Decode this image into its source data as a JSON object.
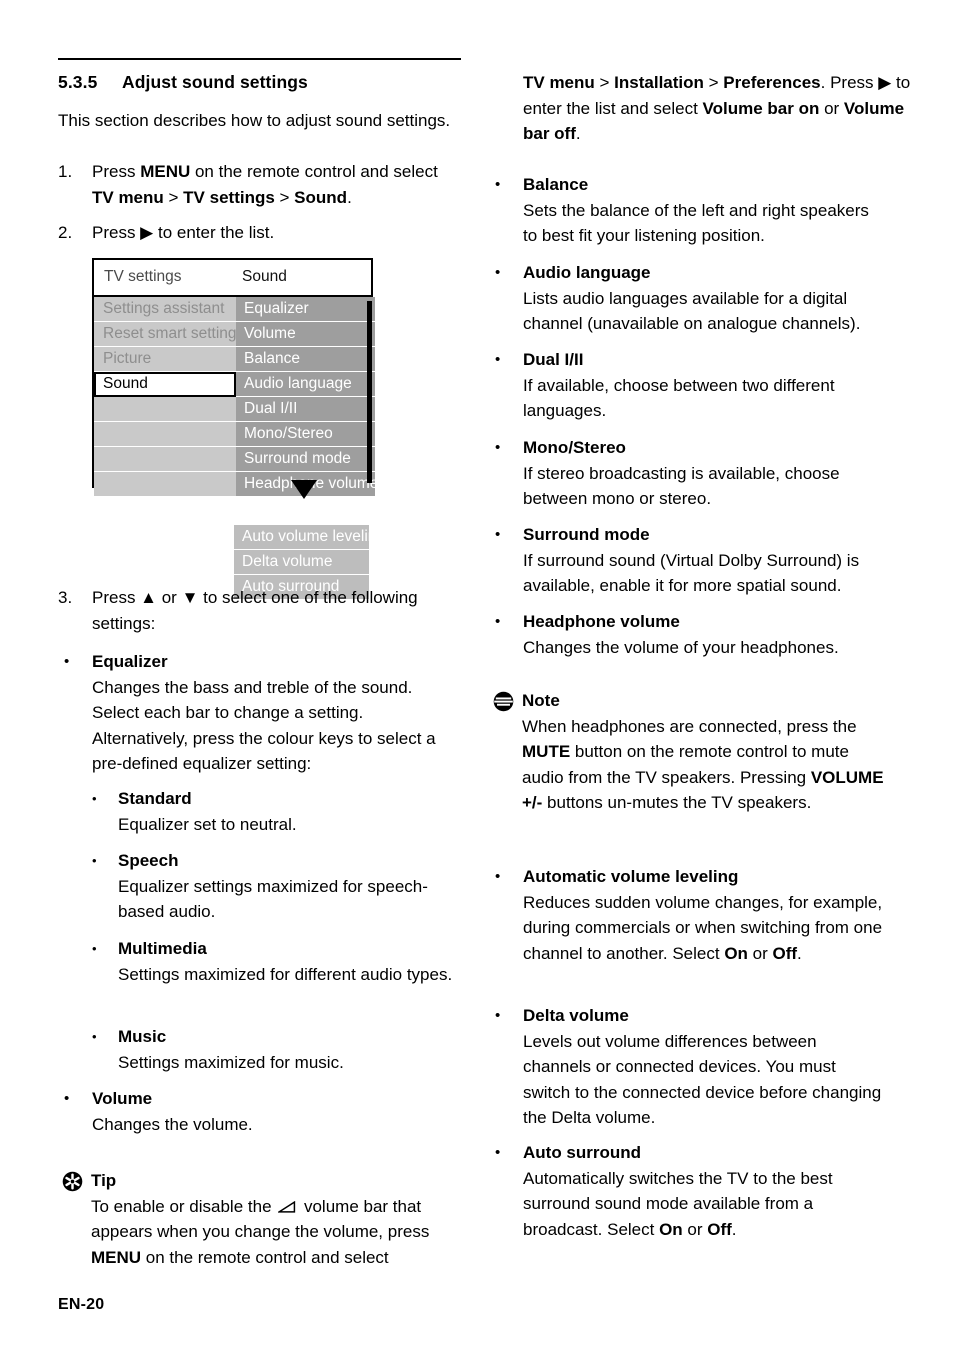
{
  "page": {
    "footer": "EN-20",
    "section_number": "5.3.5",
    "section_title": "Adjust sound settings"
  },
  "left_column": {
    "intro": "This section describes how to adjust sound settings.",
    "steps": [
      {
        "number": "1.",
        "text_parts": [
          {
            "t": "Press ",
            "bold": false
          },
          {
            "t": "MENU",
            "bold": true
          },
          {
            "t": " on the remote control and select ",
            "bold": false
          },
          {
            "t": "TV menu",
            "bold": true
          },
          {
            "t": " > ",
            "bold": false
          },
          {
            "t": "TV settings",
            "bold": true
          },
          {
            "t": " > ",
            "bold": false
          },
          {
            "t": "Sound",
            "bold": true
          },
          {
            "t": ".",
            "bold": false
          }
        ],
        "plain": "Press MENU on the remote control and select TV menu > TV settings > Sound."
      },
      {
        "number": "2.",
        "plain": "Press ▶ to enter the list."
      },
      {
        "number": "3.",
        "plain": "Press ▲ or ▼ to select one of the following settings:"
      }
    ],
    "bullets": [
      {
        "term": "Equalizer",
        "desc": "Changes the bass and treble of the sound. Select each bar to change a setting. Alternatively, press the colour keys to select a pre-defined equalizer setting:",
        "subbullets": [
          {
            "term": "Standard",
            "desc": "Equalizer set to neutral."
          },
          {
            "term": "Speech",
            "desc": "Equalizer settings maximized for speech-based audio."
          },
          {
            "term": "Multimedia",
            "desc": "Settings maximized for different audio types."
          },
          {
            "term": "Music",
            "desc": "Settings maximized for music."
          }
        ]
      },
      {
        "term": "Volume",
        "desc": "Changes the volume."
      }
    ],
    "tip": {
      "icon": "tip-asterisk-icon",
      "heading": "Tip",
      "body_pre": "To enable or disable the ",
      "glyph": "volume-bar-icon",
      "body_mid": " volume bar that appears when you change the volume, press ",
      "body_bold": "MENU",
      "body_post": " on the remote control and select"
    }
  },
  "tv_menu": {
    "header_left": "TV settings",
    "header_right": "Sound",
    "left_items": [
      {
        "label": "Settings assistant",
        "state": "normal"
      },
      {
        "label": "Reset smart settings",
        "state": "normal"
      },
      {
        "label": "Picture",
        "state": "normal"
      },
      {
        "label": "Sound",
        "state": "selected"
      },
      {
        "label": "",
        "state": "blank"
      },
      {
        "label": "",
        "state": "blank"
      },
      {
        "label": "",
        "state": "blank"
      },
      {
        "label": "",
        "state": "blank"
      }
    ],
    "right_items": [
      "Equalizer",
      "Volume",
      "Balance",
      "Audio language",
      "Dual I/II",
      "Mono/Stereo",
      "Surround mode",
      "Headphone volume"
    ],
    "overflow_items": [
      "Auto volume leveling",
      "Delta volume",
      "Auto surround"
    ],
    "colors": {
      "left_row_bg": "#c9c9c9",
      "left_row_text": "#8e8e8e",
      "right_row_bg": "#9e9e9e",
      "right_row_text": "#ffffff",
      "overflow_row_bg": "#bdbdbd",
      "scrollbar": "#000000",
      "selected_bg": "#ffffff",
      "selected_text": "#000000"
    }
  },
  "right_column": {
    "continuation": {
      "line1_parts": [
        {
          "t": "TV menu",
          "bold": true
        },
        {
          "t": " > ",
          "bold": false
        },
        {
          "t": "Installation",
          "bold": true
        },
        {
          "t": " > ",
          "bold": false
        },
        {
          "t": "Preferences",
          "bold": true
        },
        {
          "t": ". Press ▶ to enter the list and select ",
          "bold": false
        },
        {
          "t": "Volume bar on",
          "bold": true
        },
        {
          "t": " or ",
          "bold": false
        },
        {
          "t": "Volume bar off",
          "bold": true
        },
        {
          "t": ".",
          "bold": false
        }
      ],
      "plain": "TV menu > Installation > Preferences. Press ▶ to enter the list and select Volume bar on or Volume bar off."
    },
    "bullets": [
      {
        "term": "Balance",
        "desc": "Sets the balance of the left and right speakers to best fit your listening position."
      },
      {
        "term": "Audio language",
        "desc": "Lists audio languages available for a digital channel (unavailable on analogue channels)."
      },
      {
        "term": "Dual I/II",
        "desc": "If available, choose between two different languages."
      },
      {
        "term": "Mono/Stereo",
        "desc": "If stereo broadcasting is available, choose between mono or stereo."
      },
      {
        "term": "Surround mode",
        "desc": "If surround sound (Virtual Dolby Surround) is available, enable it for more spatial sound."
      },
      {
        "term": "Headphone volume",
        "desc": "Changes the volume of your headphones."
      }
    ],
    "note": {
      "icon": "note-lines-icon",
      "heading": "Note",
      "part1": "When headphones are connected, press the ",
      "bold1": "MUTE",
      "part2": " button on the remote control to mute audio from the TV speakers. Pressing ",
      "bold2": "VOLUME +/-",
      "part3": " buttons un-mutes the TV speakers."
    },
    "bullets_after_note": [
      {
        "term": "Automatic volume leveling",
        "part1": "Reduces sudden volume changes, for example, during commercials or when switching from one channel to another. Select ",
        "bold1": "On",
        "part2": " or ",
        "bold2": "Off",
        "part3": "."
      },
      {
        "term": "Delta volume",
        "part1": "Levels out volume differences between channels or connected devices. You must switch to the connected device before changing the Delta volume.",
        "bold1": "",
        "part2": "",
        "bold2": "",
        "part3": ""
      },
      {
        "term": "Auto surround",
        "part1": "Automatically switches the TV to the best surround sound mode available from a broadcast. Select ",
        "bold1": "On",
        "part2": " or ",
        "bold2": "Off",
        "part3": "."
      }
    ]
  }
}
